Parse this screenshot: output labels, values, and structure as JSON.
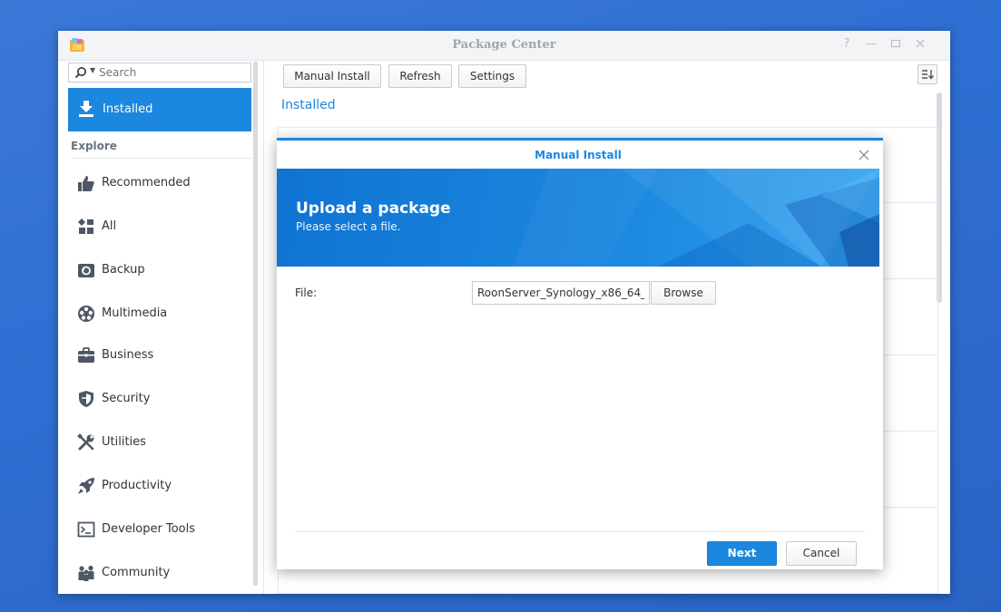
{
  "window": {
    "title": "Package Center",
    "controls": [
      "help-icon",
      "minimize-icon",
      "maximize-icon",
      "close-icon"
    ]
  },
  "sidebar": {
    "search_placeholder": "Search",
    "installed_label": "Installed",
    "section_label": "Explore",
    "items": [
      {
        "label": "Recommended",
        "icon": "thumbs-up-icon"
      },
      {
        "label": "All",
        "icon": "grid-icon"
      },
      {
        "label": "Backup",
        "icon": "backup-icon"
      },
      {
        "label": "Multimedia",
        "icon": "film-reel-icon"
      },
      {
        "label": "Business",
        "icon": "briefcase-icon"
      },
      {
        "label": "Security",
        "icon": "shield-icon"
      },
      {
        "label": "Utilities",
        "icon": "tools-icon"
      },
      {
        "label": "Productivity",
        "icon": "rocket-icon"
      },
      {
        "label": "Developer Tools",
        "icon": "terminal-icon"
      },
      {
        "label": "Community",
        "icon": "people-icon"
      }
    ]
  },
  "toolbar": {
    "manual_install_label": "Manual Install",
    "refresh_label": "Refresh",
    "settings_label": "Settings"
  },
  "main": {
    "title": "Installed"
  },
  "dialog": {
    "title": "Manual Install",
    "banner_heading": "Upload a package",
    "banner_subheading": "Please select a file.",
    "file_label": "File:",
    "file_value": "RoonServer_Synology_x86_64_",
    "browse_label": "Browse",
    "next_label": "Next",
    "cancel_label": "Cancel"
  },
  "colors": {
    "accent": "#1b87de",
    "desktop": "#2f6fd3",
    "sidebar_icon": "#4d5766"
  }
}
